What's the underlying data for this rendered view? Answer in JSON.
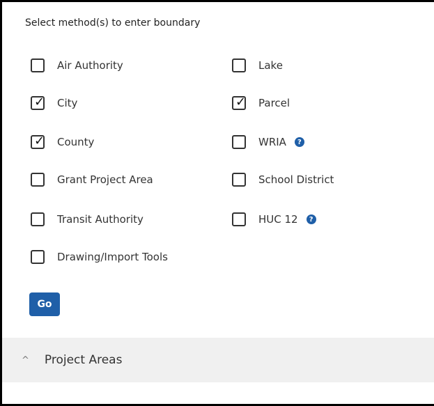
{
  "heading": "Select method(s) to enter boundary",
  "options": [
    {
      "label": "Air Authority",
      "checked": false,
      "help": false
    },
    {
      "label": "Lake",
      "checked": false,
      "help": false
    },
    {
      "label": "City",
      "checked": true,
      "help": false
    },
    {
      "label": "Parcel",
      "checked": true,
      "help": false
    },
    {
      "label": "County",
      "checked": true,
      "help": false
    },
    {
      "label": "WRIA",
      "checked": false,
      "help": true
    },
    {
      "label": "Grant Project Area",
      "checked": false,
      "help": false
    },
    {
      "label": "School District",
      "checked": false,
      "help": false
    },
    {
      "label": "Transit Authority",
      "checked": false,
      "help": false
    },
    {
      "label": "HUC 12",
      "checked": false,
      "help": true
    },
    {
      "label": "Drawing/Import Tools",
      "checked": false,
      "help": false
    }
  ],
  "check_mark": "✓",
  "help_glyph": "?",
  "go_label": "Go",
  "section": {
    "title": "Project Areas",
    "chevron": "^"
  },
  "colors": {
    "accent": "#1f5fa8",
    "section_bg": "#f0f0f0"
  }
}
